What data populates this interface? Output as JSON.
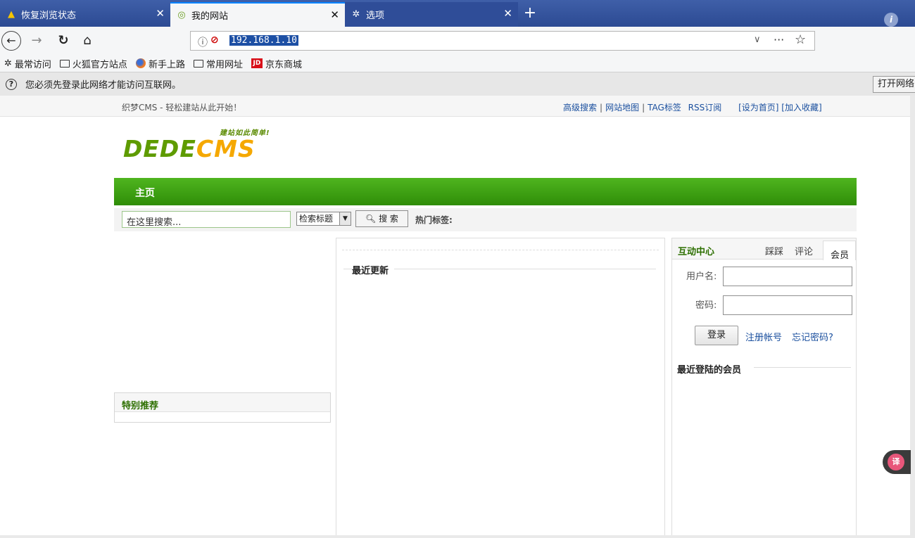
{
  "browser": {
    "tabs": [
      {
        "label": "恢复浏览状态",
        "icon": "warning-icon",
        "active": false
      },
      {
        "label": "我的网站",
        "icon": "site-icon",
        "active": true
      },
      {
        "label": "选项",
        "icon": "gear-icon",
        "active": false
      }
    ],
    "new_tab": "+",
    "url": "192.168.1.10",
    "bookmarks": [
      {
        "label": "最常访问",
        "icon": "gear-icon"
      },
      {
        "label": "火狐官方站点",
        "icon": "folder-icon"
      },
      {
        "label": "新手上路",
        "icon": "firefox-icon"
      },
      {
        "label": "常用网址",
        "icon": "folder-icon"
      },
      {
        "label": "京东商城",
        "icon": "jd-icon"
      }
    ],
    "notification": {
      "text": "您必须先登录此网络才能访问互联网。",
      "button": "打开网络"
    }
  },
  "site": {
    "slogan": "织梦CMS - 轻松建站从此开始！",
    "top_links": {
      "advanced_search": "高级搜索",
      "sitemap": "网站地图",
      "tags": "TAG标签",
      "rss": "RSS订阅",
      "set_home": "[设为首页]",
      "add_fav": "[加入收藏]"
    },
    "logo": {
      "tagline": "建站如此简单!",
      "text_dede": "DEDE",
      "text_cms": "CMS",
      "colors": {
        "dede": "#5e9b00",
        "cms": "#f5a800"
      }
    },
    "nav": {
      "home": "主页"
    },
    "search": {
      "placeholder": "在这里搜索...",
      "select_value": "检索标题",
      "button": "搜 索",
      "hot_tags_label": "热门标签:"
    },
    "left": {
      "special_title": "特别推荐"
    },
    "center": {
      "latest_title": "最近更新"
    },
    "right": {
      "title": "互动中心",
      "tabs": [
        "踩踩",
        "评论",
        "会员"
      ],
      "username_label": "用户名:",
      "password_label": "密码:",
      "login_button": "登录",
      "register_link": "注册帐号",
      "forgot_link": "忘记密码?",
      "recent_members": "最近登陆的会员"
    }
  },
  "colors": {
    "nav_green": "#3aa012",
    "tab_bar_blue": "#2c4a93",
    "link_blue": "#1a4f9e",
    "heading_green": "#2d6f00"
  }
}
